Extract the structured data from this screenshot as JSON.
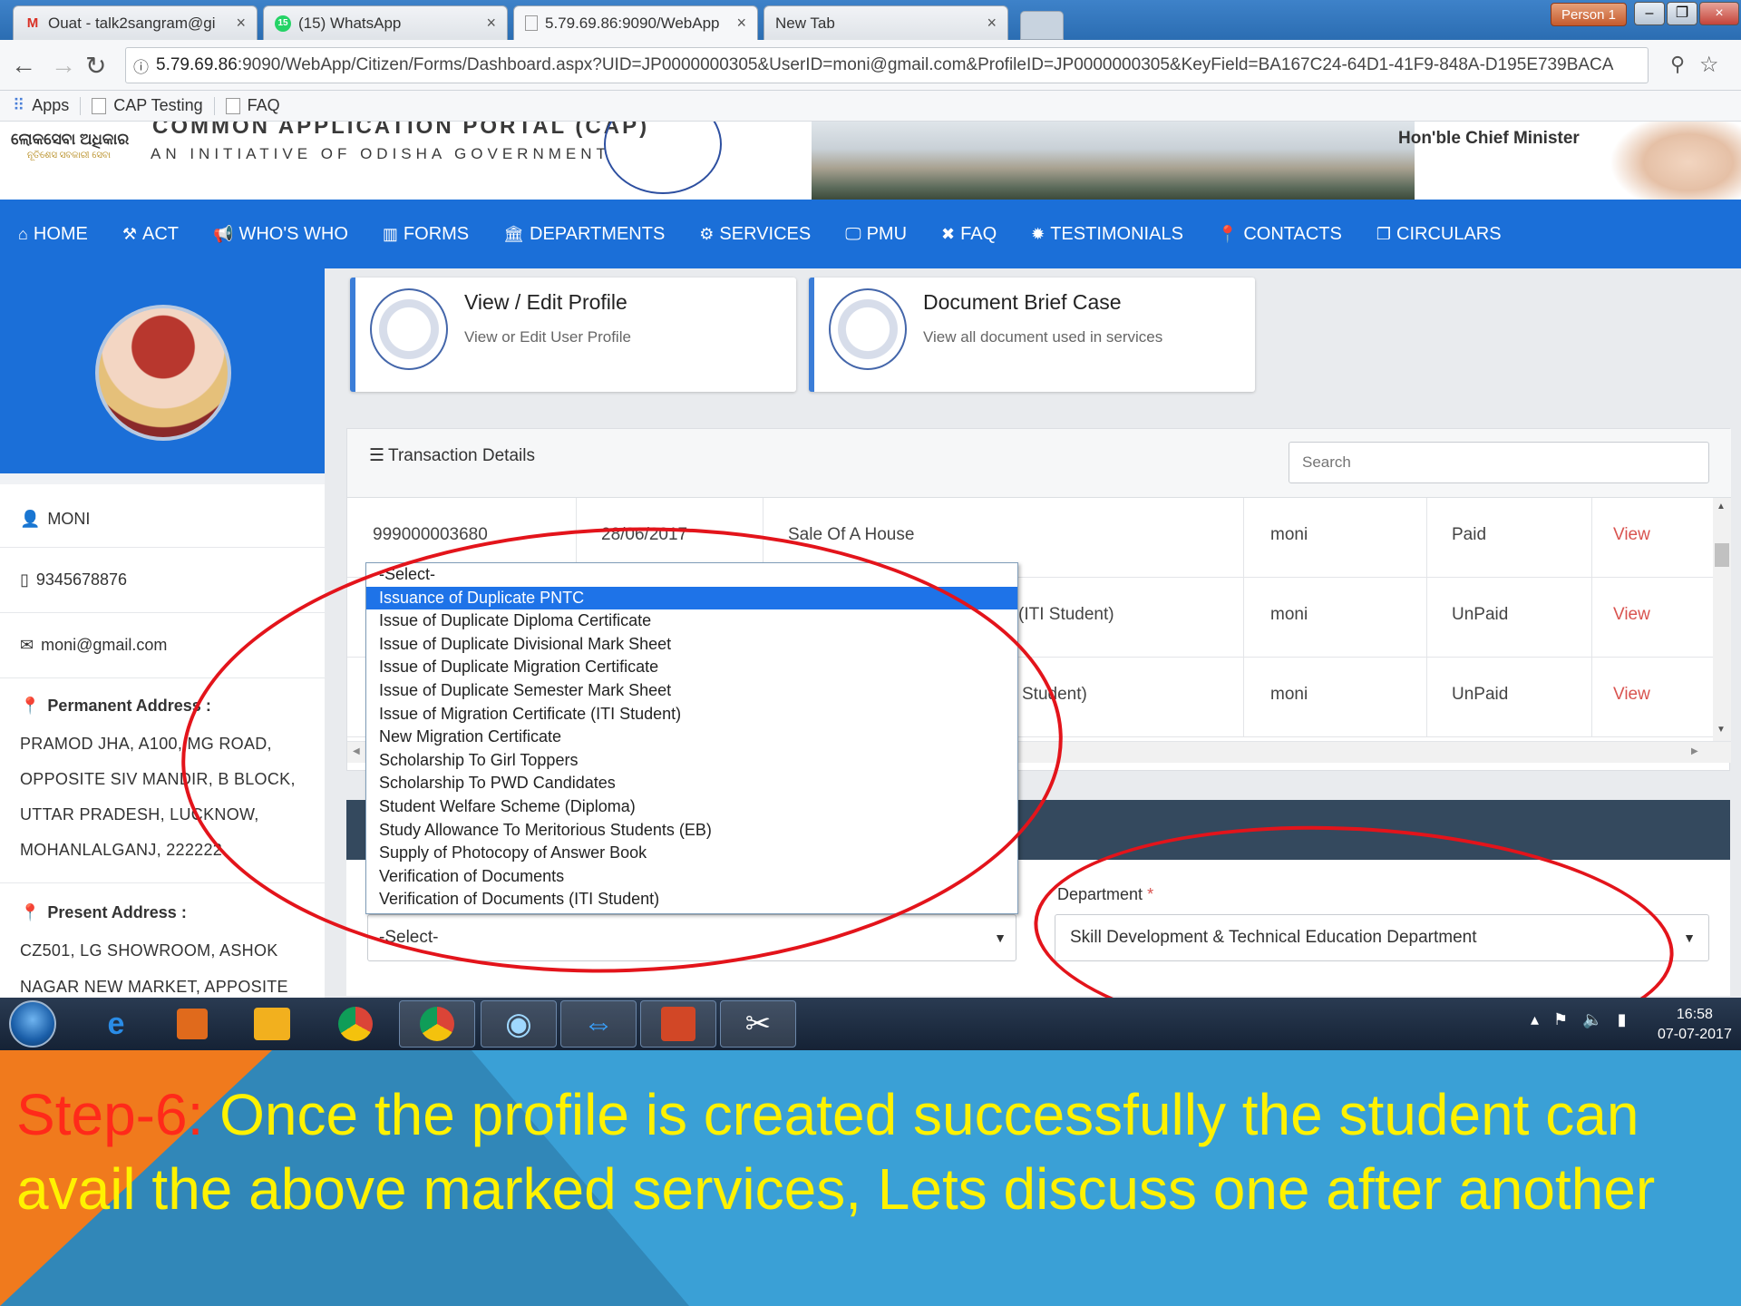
{
  "browser": {
    "tabs": [
      {
        "title": "Ouat - talk2sangram@gi",
        "icon": "M"
      },
      {
        "title": "(15) WhatsApp",
        "icon": "15"
      },
      {
        "title": "5.79.69.86:9090/WebApp",
        "icon": ""
      },
      {
        "title": "New Tab",
        "icon": ""
      }
    ],
    "person": "Person 1",
    "url_host": "5.79.69.86",
    "url_rest": ":9090/WebApp/Citizen/Forms/Dashboard.aspx?UID=JP0000000305&UserID=moni@gmail.com&ProfileID=JP0000000305&KeyField=BA167C24-64D1-41F9-848A-D195E739BACA",
    "bookmarks": [
      "Apps",
      "CAP Testing",
      "FAQ"
    ]
  },
  "header": {
    "odia_name": "ଲୋକସେବା ଅଧିକାର",
    "odia_sub": "ନୂତିଶେସ ସବକାରୀ ସେବା",
    "portal_title": "COMMON APPLICATION PORTAL (CAP)",
    "portal_sub": "AN INITIATIVE OF ODISHA GOVERNMENT",
    "cm_label": "Hon'ble Chief Minister"
  },
  "nav": [
    {
      "label": "HOME",
      "icon": "home-icon",
      "glyph": "⌂"
    },
    {
      "label": "ACT",
      "icon": "gavel-icon",
      "glyph": "⚒"
    },
    {
      "label": "WHO'S WHO",
      "icon": "bullhorn-icon",
      "glyph": "📢"
    },
    {
      "label": "FORMS",
      "icon": "columns-icon",
      "glyph": "▥"
    },
    {
      "label": "DEPARTMENTS",
      "icon": "bank-icon",
      "glyph": "🏛"
    },
    {
      "label": "SERVICES",
      "icon": "cogs-icon",
      "glyph": "⚙"
    },
    {
      "label": "PMU",
      "icon": "desktop-icon",
      "glyph": "🖵"
    },
    {
      "label": "FAQ",
      "icon": "tools-icon",
      "glyph": "✖"
    },
    {
      "label": "TESTIMONIALS",
      "icon": "certificate-icon",
      "glyph": "✹"
    },
    {
      "label": "CONTACTS",
      "icon": "map-marker-icon",
      "glyph": "📍"
    },
    {
      "label": "CIRCULARS",
      "icon": "copy-icon",
      "glyph": "❐"
    }
  ],
  "profile": {
    "name": "MONI",
    "phone": "9345678876",
    "email": "moni@gmail.com",
    "permanent_label": "Permanent Address :",
    "permanent_lines": [
      "PRAMOD JHA, A100, MG ROAD,",
      "OPPOSITE SIV MANDIR, B BLOCK,",
      "UTTAR PRADESH, LUCKNOW,",
      "MOHANLALGANJ, 222222"
    ],
    "present_label": "Present Address :",
    "present_lines": [
      "CZ501, LG SHOWROOM, ASHOK",
      "NAGAR NEW MARKET, APPOSITE"
    ]
  },
  "cards": [
    {
      "title": "View / Edit Profile",
      "subtitle": "View or Edit User Profile"
    },
    {
      "title": "Document Brief Case",
      "subtitle": "View all document used in services"
    }
  ],
  "transactions": {
    "title": "Transaction Details",
    "search_placeholder": "Search",
    "rows": [
      {
        "id": "999000003680",
        "date": "28/06/2017",
        "service": "Sale Of A House",
        "user": "moni",
        "status": "Paid",
        "action": "View"
      },
      {
        "id": "",
        "date": "",
        "service": "(ITI Student)",
        "user": "moni",
        "status": "UnPaid",
        "action": "View"
      },
      {
        "id": "",
        "date": "",
        "service": "Student)",
        "user": "moni",
        "status": "UnPaid",
        "action": "View"
      }
    ]
  },
  "form": {
    "department_label": "Department",
    "required_mark": "*",
    "department_value": "Skill Development & Technical Education Department",
    "service_value": "-Select-",
    "service_options": [
      "-Select-",
      "Issuance of Duplicate PNTC",
      "Issue of Duplicate Diploma Certificate",
      "Issue of Duplicate Divisional Mark Sheet",
      "Issue of Duplicate Migration Certificate",
      "Issue of Duplicate Semester Mark Sheet",
      "Issue of Migration Certificate (ITI Student)",
      "New Migration Certificate",
      "Scholarship To Girl Toppers",
      "Scholarship To PWD Candidates",
      "Student Welfare Scheme (Diploma)",
      "Study Allowance To Meritorious Students (EB)",
      "Supply of Photocopy of Answer Book",
      "Verification of Documents",
      "Verification of Documents (ITI Student)"
    ],
    "selected_index": 1
  },
  "taskbar": {
    "time": "16:58",
    "date": "07-07-2017"
  },
  "slide": {
    "step": "Step-6:",
    "text": " Once the profile is created successfully the  student can avail the above marked services, Lets discuss one after another"
  },
  "colors": {
    "nav_blue": "#1b6fd8",
    "annotation_red": "#e3141b",
    "caption_yellow": "#fff200",
    "step_red": "#ff2a1a",
    "slide_blue": "#3aa0d6"
  }
}
